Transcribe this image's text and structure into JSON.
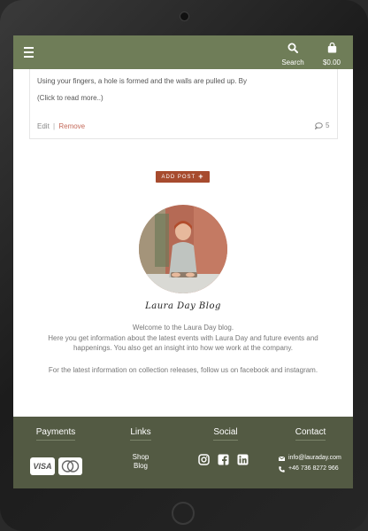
{
  "header": {
    "search_label": "Search",
    "cart_total": "$0.00"
  },
  "post": {
    "excerpt": "Using your fingers, a hole is formed and the walls are pulled up. By",
    "read_more": "(Click to read more..)",
    "edit_label": "Edit",
    "separator": "|",
    "remove_label": "Remove",
    "comment_count": "5"
  },
  "add_post_label": "ADD POST",
  "blog": {
    "signature": "Laura Day Blog",
    "intro_line1": "Welcome to the Laura Day blog.",
    "intro_line2": "Here you get information about the latest events with Laura Day and future events and happenings. You also get an insight into how we work at the company.",
    "intro_line3": "For the latest information on collection releases, follow us on facebook and instagram."
  },
  "footer": {
    "payments_title": "Payments",
    "links_title": "Links",
    "social_title": "Social",
    "contact_title": "Contact",
    "payment_methods": [
      "VISA",
      "mastercard"
    ],
    "links": [
      "Shop",
      "Blog"
    ],
    "social_icons": [
      "instagram-icon",
      "facebook-icon",
      "linkedin-icon"
    ],
    "email": "info@lauraday.com",
    "phone": "+46 736 8272 966"
  },
  "colors": {
    "topbar": "#6f7d58",
    "footer": "#535a43",
    "accent_button": "#a74b2e",
    "remove_link": "#c46a5a"
  }
}
